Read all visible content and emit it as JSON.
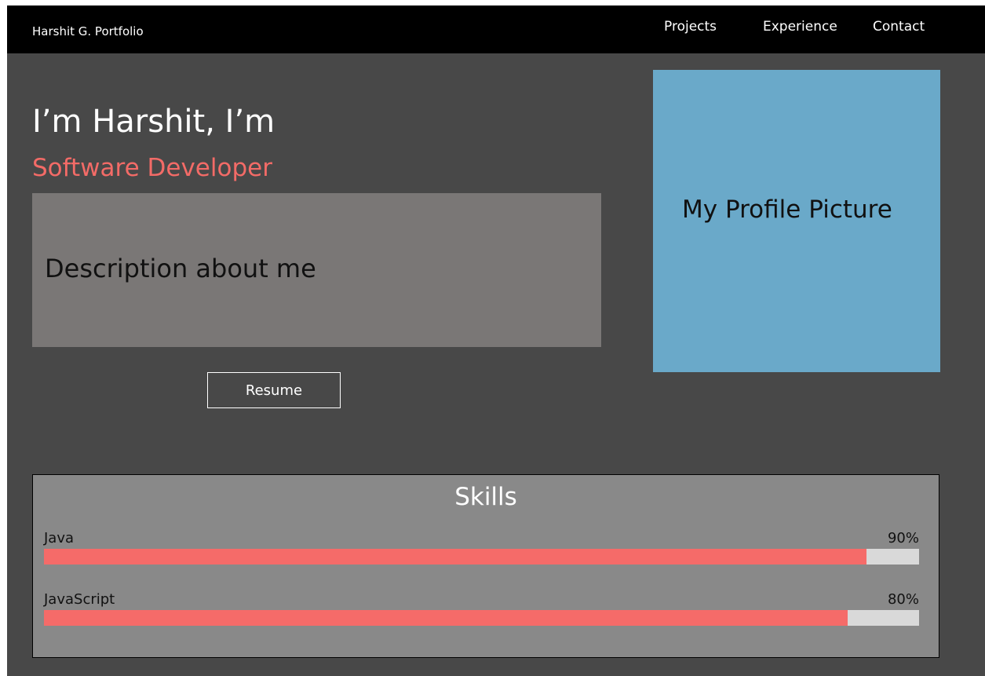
{
  "navbar": {
    "brand": "Harshit G. Portfolio",
    "links": [
      "Projects",
      "Experience",
      "Contact"
    ]
  },
  "hero": {
    "greeting": "I’m Harshit, I’m",
    "role": "Software Developer",
    "description": "Description about me",
    "resume_label": "Resume",
    "profile_picture_label": "My Profile Picture"
  },
  "skills": {
    "title": "Skills",
    "items": [
      {
        "name": "Java",
        "percent_label": "90%",
        "level": 0.94
      },
      {
        "name": "JavaScript",
        "percent_label": "80%",
        "level": 0.918
      }
    ]
  },
  "colors": {
    "page_background": "#484848",
    "navbar_background": "#000000",
    "accent": "#f36b67",
    "description_box": "#7a7776",
    "profile_picture": "#6aa9c9",
    "skills_panel": "#898989",
    "skill_bar_fill": "#f56b69",
    "skill_bar_track": "#d9d9d9"
  }
}
